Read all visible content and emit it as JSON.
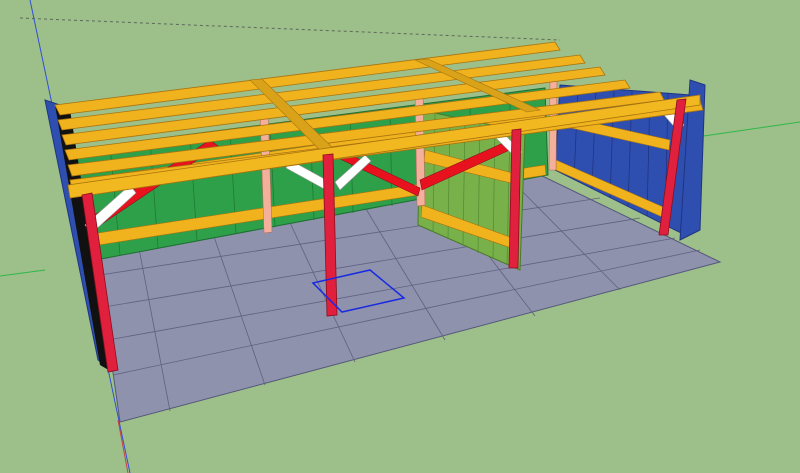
{
  "scene": {
    "description_visible_text": "",
    "colors": {
      "background": "#9dbf8a",
      "floor": "#8e92ad",
      "floor_grid": "#5f6180",
      "rafter": "#f0b21d",
      "rafter_edge": "#a87410",
      "post": "#e0203c",
      "post_edge": "#8a0e1e",
      "brace_red": "#e8121e",
      "brace_white": "#ffffff",
      "wall_green": "#2ea04a",
      "wall_green_dark": "#1d7a34",
      "wall_light_green": "#78b04a",
      "wall_blue": "#2f4fb0",
      "wall_blue_dark": "#1f3480",
      "stud_pink": "#f4b09a",
      "selection_blue": "#1a2ae0",
      "axis_green": "#2fb84a",
      "axis_blue": "#3050d8",
      "axis_red": "#d04040"
    },
    "icons": []
  }
}
